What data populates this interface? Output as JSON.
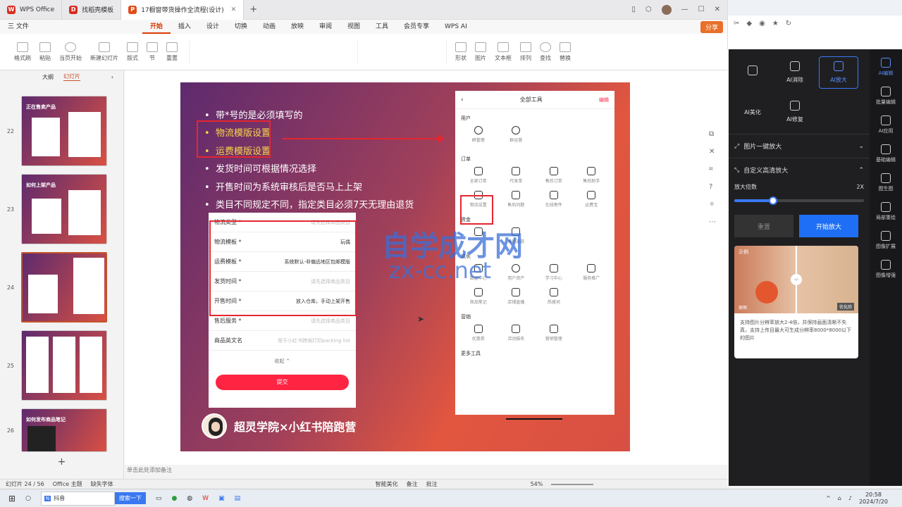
{
  "titlebar": {
    "tabs": [
      {
        "label": "WPS Office",
        "color": "#d92d20",
        "letter": "W"
      },
      {
        "label": "找稻壳模板",
        "color": "#d92d20",
        "letter": "D"
      },
      {
        "label": "17橱窗带货操作全流程(设计)",
        "color": "#e04e1b",
        "letter": "P"
      }
    ]
  },
  "menubar": {
    "file": "三 文件",
    "items": [
      "开始",
      "插入",
      "设计",
      "切换",
      "动画",
      "放映",
      "审阅",
      "视图",
      "工具",
      "会员专享"
    ],
    "active": "开始",
    "wps_ai": "WPS AI",
    "share": "分享"
  },
  "ribbon": {
    "buttons": [
      "格式刷",
      "粘贴",
      "当页开始",
      "新建幻灯片",
      "版式",
      "节",
      "重置",
      "形状",
      "图片",
      "文本框",
      "排列",
      "查找",
      "替换"
    ]
  },
  "leftpanel": {
    "tabs": [
      "大纲",
      "幻灯片"
    ],
    "active_tab": "幻灯片",
    "slides": [
      {
        "num": "22",
        "title": "正在售卖产品"
      },
      {
        "num": "23",
        "title": "如何上架产品"
      },
      {
        "num": "24",
        "title": ""
      },
      {
        "num": "25",
        "title": ""
      },
      {
        "num": "26",
        "title": "如何发布商品笔记"
      }
    ],
    "add": "+"
  },
  "slide": {
    "bullets": [
      "带*号的是必须填写的",
      "物流模版设置",
      "运费模版设置",
      "发货时间可根据情况选择",
      "开售时间为系统审核后是否马上上架",
      "类目不同规定不同，指定类目必须7天无理由退货"
    ],
    "form": {
      "rows": [
        {
          "label": "物流类型 *",
          "value": "请先选择商品类目",
          "dark": false
        },
        {
          "label": "物流模板 *",
          "value": "玩偶",
          "dark": true
        },
        {
          "label": "运费模板 *",
          "value": "系统默认-非偏远地区包邮模版",
          "dark": true
        },
        {
          "label": "发货时间 *",
          "value": "请先选择商品类目",
          "dark": false
        },
        {
          "label": "开售时间 *",
          "value": "放入仓库，手动上架开售",
          "dark": true
        },
        {
          "label": "售后服务 *",
          "value": "请先选择商品类目",
          "dark": false
        },
        {
          "label": "商品英文名",
          "value": "用于小红书跨境打印packing list",
          "dark": false
        }
      ],
      "collapse": "收起 ^",
      "submit": "提交"
    },
    "phone": {
      "title": "全部工具",
      "edit": "编辑",
      "sections": [
        {
          "name": "用户",
          "items": [
            "群管理",
            "群运营"
          ]
        },
        {
          "name": "订单",
          "items": [
            "全部订单",
            "代发单",
            "售后订单",
            "售后助手",
            "物流设置",
            "售后问题",
            "在线寄件",
            "运费宝"
          ]
        },
        {
          "name": "资金",
          "items": [
            "",
            "售后退款"
          ]
        },
        {
          "name": "成长",
          "items": [
            "数据中心",
            "用户资产",
            "学习中心",
            "服务推广",
            "商品笔记",
            "店铺直播",
            "热搜词"
          ]
        },
        {
          "name": "营销",
          "items": [
            "优惠券",
            "活动报名",
            "营销管理"
          ]
        },
        {
          "name": "更多工具",
          "items": []
        }
      ]
    },
    "watermark1": "自学成才网",
    "watermark2": "zx-cc.net",
    "footer": "超灵学院×小红书陪跑营"
  },
  "notes_placeholder": "单击此处添加备注",
  "statusbar": {
    "slide_count": "幻灯片 24 / 56",
    "theme": "Office 主题",
    "missing_font": "缺失字体",
    "beautify": "智能美化",
    "notes": "备注",
    "comment": "批注",
    "zoom": "54%"
  },
  "rpanel": {
    "tools": [
      "",
      "AI消除",
      "AI放大",
      "AI美化",
      "AI修复"
    ],
    "active_tool": "AI放大",
    "section1": "图片一键放大",
    "section2": "自定义高清放大",
    "scale_label": "放大倍数",
    "scale_value": "2X",
    "scale_fraction": 0.3,
    "reset": "重置",
    "start": "开始放大",
    "example": "示例",
    "orig": "原图",
    "optimized": "优化后",
    "desc": "支持图片分辨率放大2-4倍，并保持画面清晰不失真，支持上传目最大可生成分辨率8000*8000以下的图片"
  },
  "rside": {
    "items": [
      "AI编辑",
      "批量编辑",
      "AI应用",
      "基础编辑",
      "图生图",
      "局部重绘",
      "图像扩展",
      "图像增强"
    ]
  },
  "taskbar": {
    "search": "抖音",
    "search_btn": "搜索一下",
    "time": "20:58",
    "date": "2024/7/20"
  }
}
